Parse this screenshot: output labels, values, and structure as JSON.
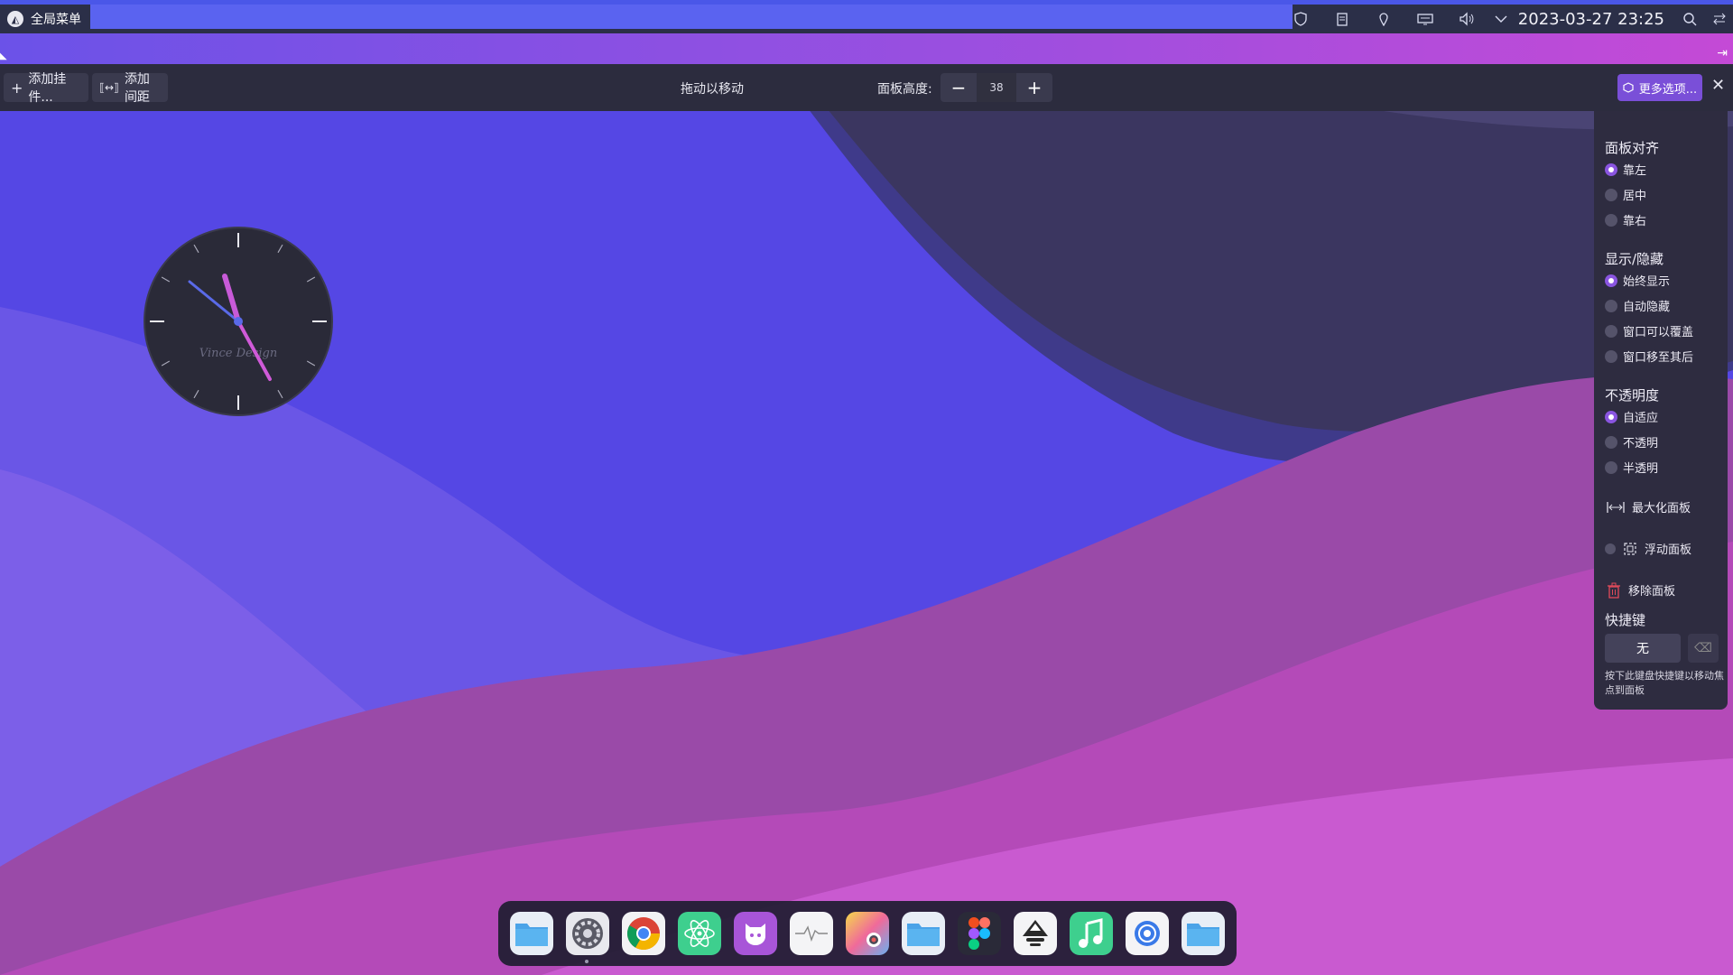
{
  "top_panel": {
    "global_menu_label": "全局菜单",
    "clock_text": "2023-03-27 23:25",
    "tray_icons": [
      "shield-icon",
      "clipboard-icon",
      "location-icon",
      "keyboard-icon",
      "volume-icon",
      "chevron-down-icon",
      "search-icon",
      "switch-icon"
    ],
    "accent_color": "#5a63f0"
  },
  "edit_toolbar": {
    "add_widget_label": "添加挂件...",
    "add_spacer_label": "添加间距",
    "drag_to_move_label": "拖动以移动",
    "panel_height_label": "面板高度:",
    "panel_height_value": "38",
    "more_options_label": "更多选项...",
    "more_options_color": "#7a4fd8"
  },
  "options_panel": {
    "alignment": {
      "heading": "面板对齐",
      "options": [
        {
          "label": "靠左",
          "selected": true
        },
        {
          "label": "居中",
          "selected": false
        },
        {
          "label": "靠右",
          "selected": false
        }
      ]
    },
    "visibility": {
      "heading": "显示/隐藏",
      "options": [
        {
          "label": "始终显示",
          "selected": true
        },
        {
          "label": "自动隐藏",
          "selected": false
        },
        {
          "label": "窗口可以覆盖",
          "selected": false
        },
        {
          "label": "窗口移至其后",
          "selected": false
        }
      ]
    },
    "opacity": {
      "heading": "不透明度",
      "options": [
        {
          "label": "自适应",
          "selected": true
        },
        {
          "label": "不透明",
          "selected": false
        },
        {
          "label": "半透明",
          "selected": false
        }
      ]
    },
    "maximize_label": "最大化面板",
    "floating_label": "浮动面板",
    "remove_label": "移除面板",
    "shortcut_heading": "快捷键",
    "shortcut_value": "无",
    "shortcut_hint": "按下此键盘快捷键以移动焦点到面板"
  },
  "clock_widget": {
    "brand_text": "Vince Design"
  },
  "dock": {
    "items": [
      {
        "name": "files",
        "icon": "folder-icon"
      },
      {
        "name": "system-settings",
        "icon": "gear-icon"
      },
      {
        "name": "chrome",
        "icon": "chrome-icon"
      },
      {
        "name": "atom",
        "icon": "atom-icon"
      },
      {
        "name": "github",
        "icon": "github-icon"
      },
      {
        "name": "system-monitor",
        "icon": "monitor-icon"
      },
      {
        "name": "color-picker",
        "icon": "color-picker-icon"
      },
      {
        "name": "file-manager",
        "icon": "folder-icon"
      },
      {
        "name": "figma",
        "icon": "figma-icon"
      },
      {
        "name": "inkscape",
        "icon": "inkscape-icon"
      },
      {
        "name": "music",
        "icon": "music-icon"
      },
      {
        "name": "browser",
        "icon": "browser-icon"
      },
      {
        "name": "folder",
        "icon": "folder-icon"
      }
    ]
  }
}
